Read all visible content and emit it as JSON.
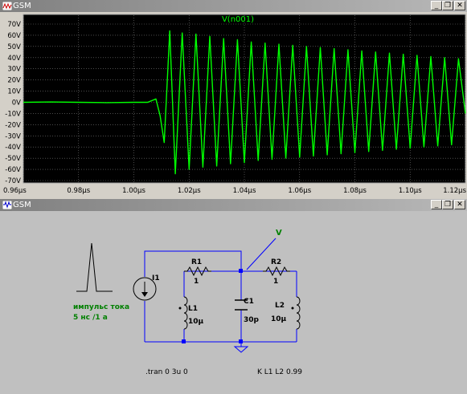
{
  "plot_window": {
    "title": "GSM",
    "buttons": {
      "minimize": "_",
      "restore": "❐",
      "close": "✕"
    },
    "colors": {
      "background": "#000000",
      "grid": "#808080",
      "trace": "#00ff00",
      "axis_text": "#ffffff"
    }
  },
  "chart_data": {
    "type": "line",
    "title": "V(n001)",
    "xlabel": "",
    "ylabel": "",
    "x_unit": "µs",
    "y_unit": "V",
    "xlim": [
      0.96,
      1.12
    ],
    "ylim": [
      -70,
      70
    ],
    "x_ticks": [
      "0.96µs",
      "0.98µs",
      "1.00µs",
      "1.02µs",
      "1.04µs",
      "1.06µs",
      "1.08µs",
      "1.10µs",
      "1.12µs"
    ],
    "y_ticks": [
      "70V",
      "60V",
      "50V",
      "40V",
      "30V",
      "20V",
      "10V",
      "0V",
      "-10V",
      "-20V",
      "-30V",
      "-40V",
      "-50V",
      "-60V",
      "-70V"
    ],
    "grid": true,
    "series": [
      {
        "name": "V(n001)",
        "color": "#00ff00",
        "x_us": [
          0.96,
          0.97,
          0.98,
          0.99,
          1.0,
          1.005,
          1.008,
          1.0095,
          1.011,
          1.013,
          1.015,
          1.0175,
          1.02,
          1.0225,
          1.025,
          1.0275,
          1.03,
          1.0325,
          1.035,
          1.0375,
          1.04,
          1.0425,
          1.045,
          1.0475,
          1.05,
          1.0525,
          1.055,
          1.0575,
          1.06,
          1.0625,
          1.065,
          1.0675,
          1.07,
          1.0725,
          1.075,
          1.0775,
          1.08,
          1.0825,
          1.085,
          1.0875,
          1.09,
          1.0925,
          1.095,
          1.0975,
          1.1,
          1.1025,
          1.105,
          1.1075,
          1.11,
          1.1125,
          1.115,
          1.1175,
          1.12
        ],
        "y_V": [
          0,
          0.3,
          0,
          -0.3,
          0,
          0,
          3,
          -12,
          -36,
          64,
          -64,
          62,
          -60,
          61,
          -58,
          59,
          -57,
          57,
          -55,
          56,
          -54,
          54,
          -52,
          53,
          -51,
          52,
          -50,
          51,
          -49,
          50,
          -48,
          49,
          -47,
          48,
          -46,
          47,
          -45,
          46,
          -44,
          45,
          -43,
          44,
          -42,
          43,
          -41,
          42,
          -40,
          41,
          -39,
          40,
          -38,
          39,
          -10
        ]
      }
    ]
  },
  "schematic_window": {
    "title": "GSM",
    "buttons": {
      "minimize": "_",
      "restore": "❐",
      "close": "✕"
    },
    "colors": {
      "background": "#c0c0c0",
      "wire": "#0000ff",
      "label": "#000000",
      "annotation": "#008000",
      "ground": "#0000ff"
    },
    "net_label": "V",
    "source": {
      "name": "I1"
    },
    "r1": {
      "name": "R1",
      "value": "1"
    },
    "r2": {
      "name": "R2",
      "value": "1"
    },
    "c1": {
      "name": "C1",
      "value": "30p"
    },
    "l1": {
      "name": "L1",
      "value": "10µ"
    },
    "l2": {
      "name": "L2",
      "value": "10µ"
    },
    "pulse_caption": [
      "импульс тока",
      "5 нс /1 а"
    ],
    "tran_directive": ".tran 0 3u 0",
    "coupling_directive": "K L1 L2 0.99"
  }
}
